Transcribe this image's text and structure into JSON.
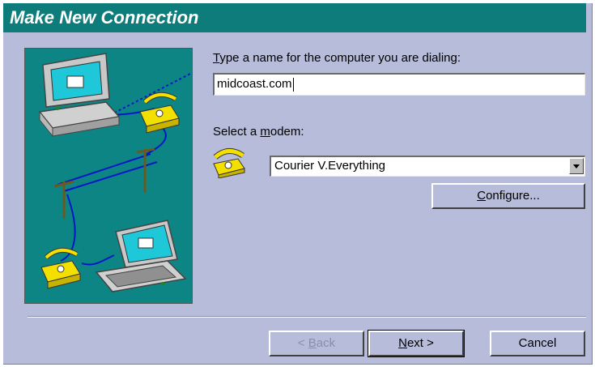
{
  "window": {
    "title": "Make New Connection"
  },
  "computer_name": {
    "label_prefix": "T",
    "label_rest": "ype a name for the computer you are dialing:",
    "value": "midcoast.com"
  },
  "modem": {
    "label_prefix": "Select a ",
    "label_underline": "m",
    "label_rest": "odem:",
    "selected": "Courier V.Everything"
  },
  "buttons": {
    "configure_u": "C",
    "configure_rest": "onfigure...",
    "back_prefix": "< ",
    "back_u": "B",
    "back_rest": "ack",
    "next_u": "N",
    "next_rest": "ext >",
    "cancel": "Cancel"
  },
  "colors": {
    "titlebar": "#0e7c7b",
    "dialog_bg": "#b6bcd9",
    "illustration_bg": "#0e8585"
  },
  "icons": [
    "computer-icon",
    "telephone-icon",
    "laptop-icon",
    "modem-phone-icon",
    "dropdown-arrow-icon"
  ]
}
